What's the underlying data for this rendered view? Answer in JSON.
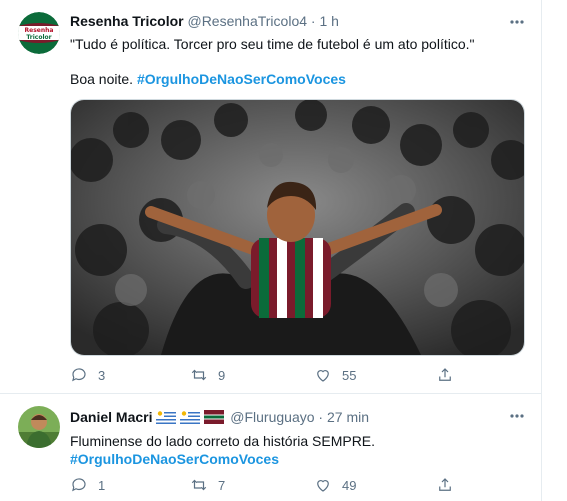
{
  "tweets": [
    {
      "display_name": "Resenha Tricolor",
      "handle": "@ResenhaTricolo4",
      "separator": "·",
      "time": "1 h",
      "avatar_text": [
        "Resenha",
        "Tricolor"
      ],
      "text_line1": "\"Tudo é política. Torcer pro seu time de futebol é um ato político.\"",
      "text_line2_plain": "Boa noite. ",
      "text_line2_tag": "#OrgulhoDeNaoSerComoVoces",
      "replies": "3",
      "retweets": "9",
      "likes": "55"
    },
    {
      "display_name": "Daniel Macri",
      "handle": "@Fluruguayo",
      "separator": "·",
      "time": "27 min",
      "text_line1": "Fluminense do lado correto da história SEMPRE.",
      "text_line2_tag": "#OrgulhoDeNaoSerComoVoces",
      "replies": "1",
      "retweets": "7",
      "likes": "49"
    }
  ],
  "colors": {
    "accent": "#1b95e0",
    "muted": "#5b7083",
    "border": "#e6ecf0",
    "fluminense_green": "#0b6b3a",
    "fluminense_maroon": "#7a1b2b"
  },
  "icons": [
    "more-icon",
    "reply-icon",
    "retweet-icon",
    "like-icon",
    "share-icon"
  ]
}
